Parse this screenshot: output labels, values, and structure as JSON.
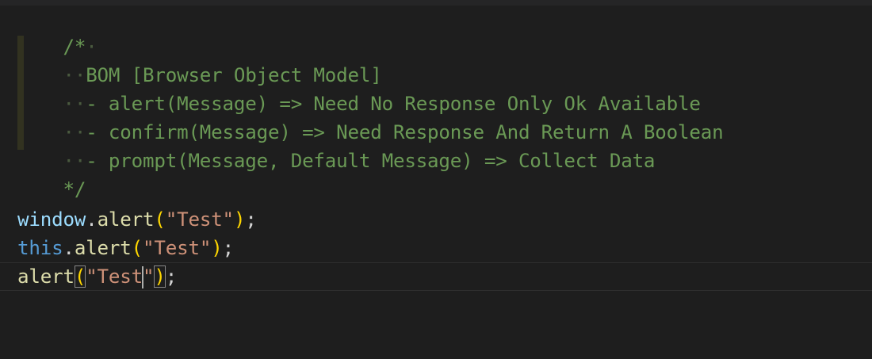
{
  "editor": {
    "comment": {
      "open": "/*",
      "title": "BOM [Browser Object Model]",
      "items": [
        "- alert(Message) => Need No Response Only Ok Available",
        "- confirm(Message) => Need Response And Return A Boolean",
        "- prompt(Message, Default Message) => Collect Data"
      ],
      "close": "*/"
    },
    "code": [
      {
        "object": "window",
        "dot": ".",
        "method": "alert",
        "open_paren": "(",
        "string": "\"Test\"",
        "close_paren": ")",
        "semi": ";"
      },
      {
        "object": "this",
        "dot": ".",
        "method": "alert",
        "open_paren": "(",
        "string": "\"Test\"",
        "close_paren": ")",
        "semi": ";"
      },
      {
        "method": "alert",
        "open_paren": "(",
        "string_before_cursor": "\"Test",
        "string_after_cursor": "\"",
        "close_paren": ")",
        "semi": ";"
      }
    ]
  },
  "colors": {
    "background": "#1e1e1e",
    "comment": "#6a9955",
    "variable": "#9cdcfe",
    "function": "#dcdcaa",
    "keyword": "#569cd6",
    "string": "#ce9178",
    "bracket": "#ffd700"
  }
}
